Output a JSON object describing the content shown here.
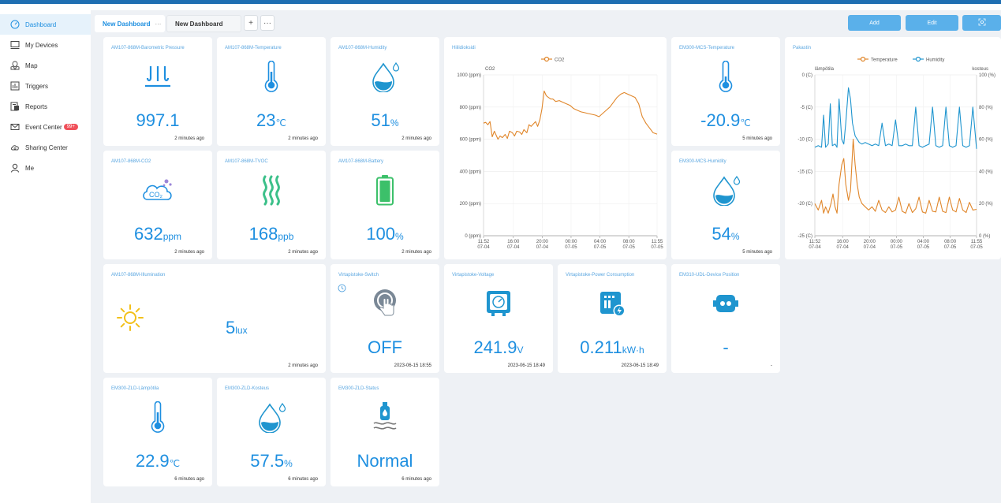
{
  "sidebar": {
    "items": [
      {
        "label": "Dashboard",
        "active": true
      },
      {
        "label": "My Devices"
      },
      {
        "label": "Map"
      },
      {
        "label": "Triggers"
      },
      {
        "label": "Reports"
      },
      {
        "label": "Event Center",
        "badge": "99+"
      },
      {
        "label": "Sharing Center"
      },
      {
        "label": "Me"
      }
    ]
  },
  "tabs": {
    "tab1": "New Dashboard",
    "tab1_more": "···",
    "tab2": "New Dashboard",
    "add": "+",
    "more": "···"
  },
  "actions": {
    "add": "Add",
    "edit": "Edit"
  },
  "colors": {
    "accent": "#1e8fe0",
    "title": "#5aa6e0",
    "temperature": "#e0862a",
    "humidity": "#1f95cf",
    "battery": "#3cc06a",
    "tvoc": "#3cc08a",
    "illumination": "#f2c01a"
  },
  "cards": {
    "pressure": {
      "title": "AM107-868M-Barometric Pressure",
      "value": "997.1",
      "unit": "",
      "time": "2 minutes ago",
      "icon": "pressure-icon"
    },
    "temp": {
      "title": "AM107-868M-Temperature",
      "value": "23",
      "unit": "℃",
      "time": "2 minutes ago",
      "icon": "thermometer-icon"
    },
    "humidity": {
      "title": "AM107-868M-Humidity",
      "value": "51",
      "unit": "%",
      "time": "2 minutes ago",
      "icon": "water-drop-icon"
    },
    "co2": {
      "title": "AM107-868M-CO2",
      "value": "632",
      "unit": "ppm",
      "time": "2 minutes ago",
      "icon": "co2-cloud-icon"
    },
    "tvoc": {
      "title": "AM107-868M-TVOC",
      "value": "168",
      "unit": "ppb",
      "time": "2 minutes ago",
      "icon": "tvoc-waves-icon"
    },
    "battery": {
      "title": "AM107-868M-Battery",
      "value": "100",
      "unit": "%",
      "time": "2 minutes ago",
      "icon": "battery-icon",
      "level": 1.0
    },
    "em_temp": {
      "title": "EM300-MCS-Temperature",
      "value": "-20.9",
      "unit": "℃",
      "time": "5 minutes ago",
      "icon": "thermometer-icon"
    },
    "em_hum": {
      "title": "EM300-MCS-Humidity",
      "value": "54",
      "unit": "%",
      "time": "5 minutes ago",
      "icon": "water-drop-icon"
    },
    "illum": {
      "title": "AM107-868M-Illumination",
      "value": "5",
      "unit": "lux",
      "time": "2 minutes ago",
      "icon": "sun-icon"
    },
    "switch": {
      "title": "Virtapistoke-Switch",
      "value": "OFF",
      "time": "2023-06-15 18:55",
      "icon": "hand-switch-icon"
    },
    "voltage": {
      "title": "Virtapistoke-Voltage",
      "value": "241.9",
      "unit": "V",
      "time": "2023-06-15 18:49",
      "icon": "voltmeter-icon"
    },
    "power": {
      "title": "Virtapistoke-Power Consumption",
      "value": "0.211",
      "unit": "kW·h",
      "time": "2023-06-15 18:49",
      "icon": "power-meter-icon"
    },
    "position": {
      "title": "EM310-UDL-Device Position",
      "value": "-",
      "time": "-",
      "icon": "device-position-icon"
    },
    "zld_temp": {
      "title": "EM300-ZLD-Lämpötila",
      "value": "22.9",
      "unit": "℃",
      "time": "6 minutes ago",
      "icon": "thermometer-icon"
    },
    "zld_hum": {
      "title": "EM300-ZLD-Kosteus",
      "value": "57.5",
      "unit": "%",
      "time": "6 minutes ago",
      "icon": "water-drop-icon"
    },
    "zld_status": {
      "title": "EM300-ZLD-Status",
      "value": "Normal",
      "time": "6 minutes ago",
      "icon": "leak-sensor-icon"
    }
  },
  "chart_data": [
    {
      "type": "line",
      "title": "Hiilidioksidi",
      "ylabel": "CO2",
      "legend": [
        "CO2"
      ],
      "legend_position": "top",
      "grid": true,
      "ylim": [
        0,
        1000
      ],
      "y_ticks": [
        "1000 (ppm)",
        "800 (ppm)",
        "600 (ppm)",
        "400 (ppm)",
        "200 (ppm)",
        "0 (ppm)"
      ],
      "x_ticks": [
        [
          "11:52",
          "07-04"
        ],
        [
          "16:00",
          "07-04"
        ],
        [
          "20:00",
          "07-04"
        ],
        [
          "00:00",
          "07-05"
        ],
        [
          "04:00",
          "07-05"
        ],
        [
          "08:00",
          "07-05"
        ],
        [
          "11:55",
          "07-05"
        ]
      ],
      "series": [
        {
          "name": "CO2",
          "color": "#e0862a",
          "x_hours": [
            0,
            0.3,
            0.6,
            0.9,
            1.2,
            1.5,
            2.0,
            2.3,
            2.6,
            3.0,
            3.3,
            3.6,
            4.0,
            4.3,
            4.6,
            5.0,
            5.3,
            5.6,
            6.0,
            6.3,
            6.6,
            7.0,
            7.2,
            7.5,
            7.8,
            8.1,
            8.4,
            8.7,
            9.0,
            9.3,
            9.6,
            10.0,
            10.5,
            11.0,
            11.5,
            12.0,
            12.5,
            13.0,
            13.5,
            14.0,
            14.5,
            15.0,
            15.5,
            16.0,
            16.5,
            17.0,
            17.5,
            18.0,
            18.5,
            19.0,
            19.5,
            20.0,
            20.5,
            21.0,
            21.5,
            22.0,
            22.5,
            23.0,
            23.5,
            24.05
          ],
          "values": [
            700,
            705,
            690,
            710,
            615,
            650,
            600,
            620,
            610,
            630,
            605,
            650,
            640,
            620,
            650,
            645,
            630,
            660,
            640,
            690,
            680,
            700,
            710,
            680,
            720,
            790,
            900,
            870,
            860,
            850,
            850,
            835,
            840,
            830,
            820,
            810,
            790,
            780,
            770,
            765,
            760,
            755,
            750,
            740,
            760,
            780,
            800,
            830,
            860,
            880,
            890,
            880,
            870,
            860,
            820,
            740,
            700,
            670,
            640,
            632
          ]
        }
      ]
    },
    {
      "type": "line",
      "title": "Pakastin",
      "ylabel": "lämpötila",
      "y2label": "kosteus",
      "legend": [
        "Temperature",
        "Humidity"
      ],
      "legend_position": "top",
      "grid": true,
      "ylim": [
        -25,
        0
      ],
      "y2lim": [
        0,
        100
      ],
      "y_ticks": [
        "0 (C)",
        "-5 (C)",
        "-10 (C)",
        "-15 (C)",
        "-20 (C)",
        "-25 (C)"
      ],
      "y2_ticks": [
        "100 (%)",
        "80 (%)",
        "60 (%)",
        "40 (%)",
        "20 (%)",
        "0 (%)"
      ],
      "x_ticks": [
        [
          "11:52",
          "07-04"
        ],
        [
          "16:00",
          "07-04"
        ],
        [
          "20:00",
          "07-04"
        ],
        [
          "00:00",
          "07-05"
        ],
        [
          "04:00",
          "07-05"
        ],
        [
          "08:00",
          "07-05"
        ],
        [
          "11:55",
          "07-05"
        ]
      ],
      "series": [
        {
          "name": "Temperature",
          "color": "#e0862a",
          "axis": "left",
          "x_hours": [
            0,
            0.5,
            1.0,
            1.3,
            1.6,
            2.0,
            2.4,
            2.7,
            3.0,
            3.3,
            3.6,
            4.0,
            4.3,
            4.6,
            5.0,
            5.3,
            5.5,
            5.7,
            6.0,
            6.3,
            6.6,
            7.0,
            7.5,
            8.0,
            8.5,
            9.0,
            9.5,
            10.0,
            10.5,
            11.0,
            11.5,
            12.0,
            12.5,
            13.0,
            13.5,
            14.0,
            14.5,
            15.0,
            15.5,
            16.0,
            16.5,
            17.0,
            17.5,
            18.0,
            18.5,
            19.0,
            19.5,
            20.0,
            20.5,
            21.0,
            21.5,
            22.0,
            22.5,
            23.0,
            23.5,
            24.05
          ],
          "values": [
            -20,
            -21,
            -19.5,
            -21.5,
            -20.5,
            -21.5,
            -20,
            -18.5,
            -20.5,
            -21.5,
            -17,
            -14,
            -13,
            -17,
            -19.5,
            -18,
            -14,
            -10,
            -14,
            -17,
            -19,
            -20,
            -20.5,
            -21,
            -20.5,
            -21.2,
            -19.5,
            -21,
            -21.4,
            -20.5,
            -21.3,
            -21,
            -19,
            -21.2,
            -21.5,
            -20,
            -21.4,
            -20.8,
            -19,
            -21.3,
            -21.5,
            -19.5,
            -21.2,
            -21.3,
            -19,
            -21.2,
            -21.4,
            -19,
            -21,
            -21.3,
            -19.2,
            -21,
            -21.4,
            -19.8,
            -21,
            -20.9
          ]
        },
        {
          "name": "Humidity",
          "color": "#1f95cf",
          "axis": "right",
          "x_hours": [
            0,
            0.5,
            1.0,
            1.3,
            1.6,
            2.0,
            2.3,
            2.6,
            3.0,
            3.3,
            3.6,
            4.0,
            4.3,
            4.6,
            5.0,
            5.3,
            5.6,
            6.0,
            6.3,
            6.6,
            7.0,
            7.5,
            8.0,
            8.5,
            9.0,
            9.5,
            10.0,
            10.5,
            11.0,
            11.5,
            12.0,
            12.5,
            13.0,
            13.5,
            14.0,
            14.5,
            15.0,
            15.5,
            16.0,
            16.5,
            17.0,
            17.5,
            18.0,
            18.5,
            19.0,
            19.5,
            20.0,
            20.5,
            21.0,
            21.5,
            22.0,
            22.5,
            23.0,
            23.5,
            24.05
          ],
          "values": [
            55,
            56,
            55,
            75,
            55,
            57,
            82,
            56,
            57,
            55,
            85,
            60,
            57,
            70,
            92,
            85,
            70,
            62,
            60,
            58,
            57,
            58,
            57,
            56,
            57,
            56,
            70,
            56,
            57,
            56,
            72,
            56,
            56,
            57,
            56,
            56,
            80,
            56,
            55,
            56,
            57,
            80,
            56,
            55,
            56,
            80,
            56,
            55,
            56,
            80,
            56,
            55,
            56,
            80,
            54
          ]
        }
      ]
    }
  ]
}
